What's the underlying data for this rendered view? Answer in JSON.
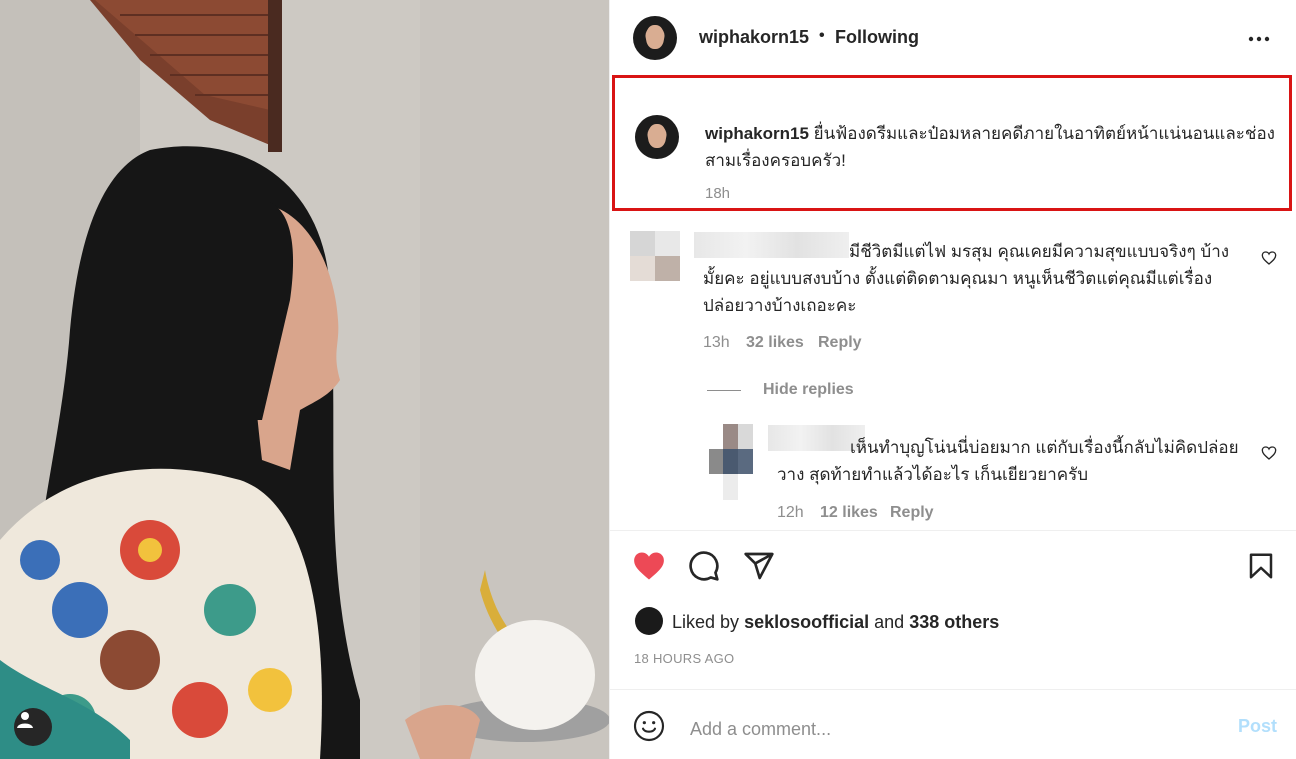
{
  "header": {
    "username": "wiphakorn15",
    "separator": "•",
    "follow_status": "Following"
  },
  "caption": {
    "username": "wiphakorn15",
    "text": "ยื่นฟ้องดรีมและป๋อมหลายคดีภายในอาทิตย์หน้าแน่นอนและช่องสามเรื่องครอบครัว!",
    "time": "18h"
  },
  "comments": [
    {
      "text": "มีชีวิตมีแต่ไฟ มรสุม คุณเคยมีความสุขแบบจริงๆ บ้างมั้ยคะ อยู่แบบสงบบ้าง ตั้งแต่ติดตามคุณมา หนูเห็นชีวิตแต่คุณมีแต่เรื่อง ปล่อยวางบ้างเถอะคะ",
      "time": "13h",
      "likes": "32 likes",
      "reply": "Reply"
    }
  ],
  "hide_replies": "Hide replies",
  "replies": [
    {
      "text": "เห็นทำบุญโน่นนี่บ่อยมาก แต่กับเรื่องนี้กลับไม่คิดปล่อยวาง สุดท้ายทำแล้วได้อะไร เก็นเยียวยาครับ",
      "time": "12h",
      "likes": "12 likes",
      "reply": "Reply"
    }
  ],
  "likes_line": {
    "prefix": "Liked by",
    "user": "seklosoofficial",
    "middle": "and",
    "others": "338 others"
  },
  "time_ago": "18 HOURS AGO",
  "add_comment": {
    "placeholder": "Add a comment...",
    "post_label": "Post"
  },
  "colors": {
    "heart": "#ed4956",
    "highlight_border": "#d91414",
    "post_disabled": "#b2dffc",
    "secondary_text": "#8e8e8e"
  },
  "icons": [
    "heart-icon",
    "comment-icon",
    "share-icon",
    "bookmark-icon",
    "more-options-icon",
    "emoji-icon",
    "user-tag-icon"
  ]
}
